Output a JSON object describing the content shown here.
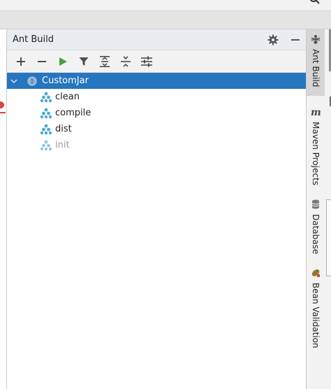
{
  "panel": {
    "title": "Ant Build"
  },
  "toolbar": {
    "buttons": [
      {
        "name": "add-button",
        "icon": "plus-icon"
      },
      {
        "name": "remove-button",
        "icon": "minus-icon"
      },
      {
        "name": "run-button",
        "icon": "play-icon",
        "color": "#4a9f45"
      },
      {
        "name": "filter-button",
        "icon": "funnel-icon"
      },
      {
        "name": "expand-all-button",
        "icon": "expand-all-icon"
      },
      {
        "name": "collapse-all-button",
        "icon": "collapse-all-icon"
      },
      {
        "name": "properties-button",
        "icon": "settings-sliders-icon"
      }
    ]
  },
  "tree": {
    "root": {
      "label": "CustomJar",
      "expanded": true,
      "selected": true
    },
    "targets": [
      {
        "label": "clean",
        "dim": false
      },
      {
        "label": "compile",
        "dim": false
      },
      {
        "label": "dist",
        "dim": false
      },
      {
        "label": "init",
        "dim": true
      }
    ]
  },
  "sidebar": {
    "tabs": [
      {
        "label": "Ant Build",
        "icon": "ant-icon",
        "active": true
      },
      {
        "label": "Maven Projects",
        "icon": "maven-icon",
        "active": false
      },
      {
        "label": "Database",
        "icon": "database-icon",
        "active": false
      },
      {
        "label": "Bean Validation",
        "icon": "bean-icon",
        "active": false
      }
    ]
  },
  "colors": {
    "selection": "#2675bf",
    "target_icon": "#4aa8d8",
    "run_green": "#4a9f45",
    "header_bg": "#e9edf2"
  }
}
